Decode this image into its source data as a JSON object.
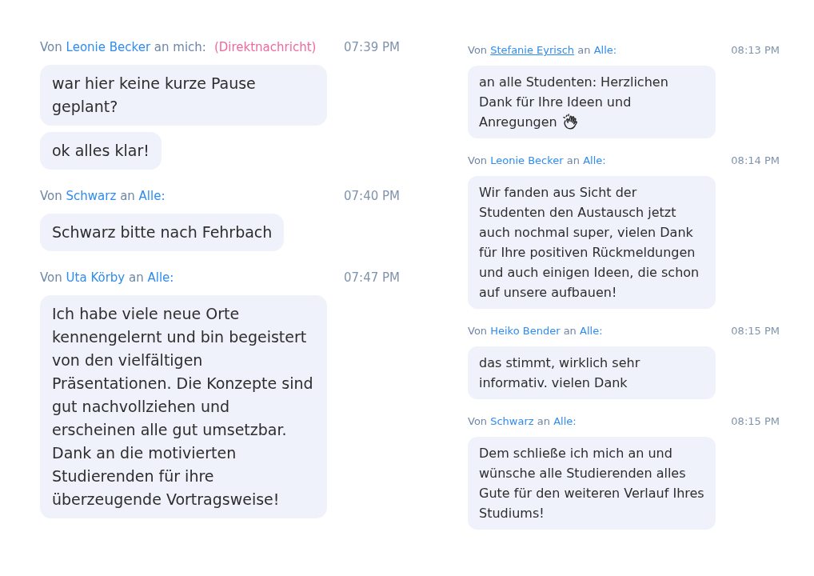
{
  "columns": [
    {
      "messages": [
        {
          "from_label": "Von",
          "sender": {
            "name": "Leonie Becker",
            "hovered": false
          },
          "to_label": "an",
          "recipient": {
            "text": "mich:",
            "link": false
          },
          "direct_label": "(Direktnachricht)",
          "time": "07:39 PM",
          "bubbles": [
            {
              "text": "war hier keine kurze Pause geplant?",
              "emoji": false
            },
            {
              "text": "ok alles klar!",
              "emoji": false
            }
          ]
        },
        {
          "from_label": "Von",
          "sender": {
            "name": "Schwarz",
            "hovered": false
          },
          "to_label": "an",
          "recipient": {
            "text": "Alle:",
            "link": true
          },
          "time": "07:40 PM",
          "bubbles": [
            {
              "text": "Schwarz bitte nach Fehrbach",
              "emoji": false
            }
          ]
        },
        {
          "from_label": "Von",
          "sender": {
            "name": "Uta Körby",
            "hovered": false
          },
          "to_label": "an",
          "recipient": {
            "text": "Alle:",
            "link": true
          },
          "time": "07:47 PM",
          "bubbles": [
            {
              "text": "Ich habe viele neue Orte kennengelernt und bin begeistert von den vielfältigen Präsentationen. Die Konzepte sind gut nachvollziehen und erscheinen alle gut umsetzbar. Dank an die motivierten Studierenden für ihre überzeugende Vortragsweise!",
              "emoji": false
            }
          ]
        }
      ]
    },
    {
      "messages": [
        {
          "from_label": "Von",
          "sender": {
            "name": "Stefanie Eyrisch",
            "hovered": true
          },
          "to_label": "an",
          "recipient": {
            "text": "Alle:",
            "link": true
          },
          "time": "08:13 PM",
          "bubbles": [
            {
              "text": "an alle Studenten: Herzlichen Dank für Ihre Ideen und Anregungen",
              "emoji": true
            }
          ]
        },
        {
          "from_label": "Von",
          "sender": {
            "name": "Leonie Becker",
            "hovered": false
          },
          "to_label": "an",
          "recipient": {
            "text": "Alle:",
            "link": true
          },
          "time": "08:14 PM",
          "bubbles": [
            {
              "text": "Wir fanden aus Sicht der Studenten den Austausch jetzt auch nochmal super, vielen Dank für Ihre positiven Rückmeldungen und auch einigen Ideen, die schon auf unsere aufbauen!",
              "emoji": false
            }
          ]
        },
        {
          "from_label": "Von",
          "sender": {
            "name": "Heiko Bender",
            "hovered": false
          },
          "to_label": "an",
          "recipient": {
            "text": "Alle:",
            "link": true
          },
          "time": "08:15 PM",
          "bubbles": [
            {
              "text": "das stimmt, wirklich sehr informativ. vielen Dank",
              "emoji": false
            }
          ]
        },
        {
          "from_label": "Von",
          "sender": {
            "name": "Schwarz",
            "hovered": false
          },
          "to_label": "an",
          "recipient": {
            "text": "Alle:",
            "link": true
          },
          "time": "08:15 PM",
          "bubbles": [
            {
              "text": "Dem schließe ich mich an und wünsche alle Studierenden alles Gute für den weiteren Verlauf Ihres Studiums!",
              "emoji": false
            }
          ]
        }
      ]
    }
  ]
}
